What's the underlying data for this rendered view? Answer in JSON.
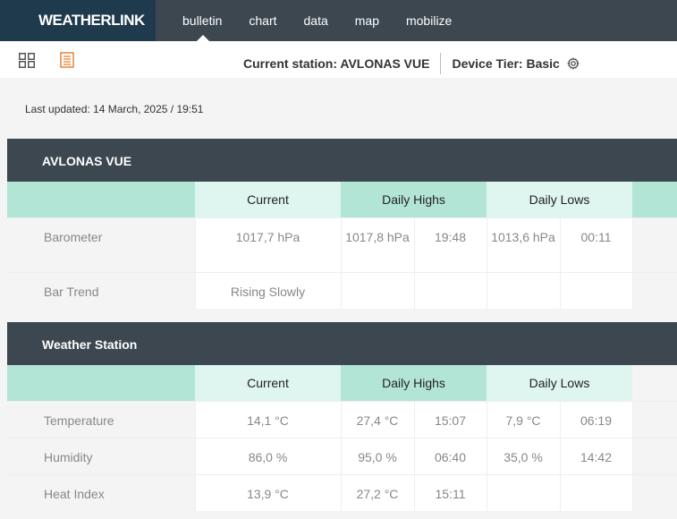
{
  "header": {
    "logo": "WEATHERLINK",
    "nav": [
      {
        "label": "bulletin"
      },
      {
        "label": "chart"
      },
      {
        "label": "data"
      },
      {
        "label": "map"
      },
      {
        "label": "mobilize"
      }
    ]
  },
  "toolbar": {
    "current_station": "Current station: AVLONAS VUE",
    "device_tier": "Device Tier: Basic",
    "grid_icon": "grid-view-icon",
    "list_icon": "list-view-icon",
    "settings_icon": "gear-icon",
    "accent_color": "#e8823a"
  },
  "last_updated": "Last updated: 14 March, 2025 / 19:51",
  "columns": {
    "current": "Current",
    "daily_highs": "Daily Highs",
    "daily_lows": "Daily Lows"
  },
  "sections": [
    {
      "title": "AVLONAS VUE",
      "rows": [
        {
          "label": "Barometer",
          "current": "1017,7 hPa",
          "high": "1017,8 hPa",
          "high_time": "19:48",
          "low": "1013,6 hPa",
          "low_time": "00:11"
        },
        {
          "label": "Bar Trend",
          "current": "Rising Slowly",
          "high": "",
          "high_time": "",
          "low": "",
          "low_time": ""
        }
      ]
    },
    {
      "title": "Weather Station",
      "rows": [
        {
          "label": "Temperature",
          "current": "14,1 °C",
          "high": "27,4 °C",
          "high_time": "15:07",
          "low": "7,9 °C",
          "low_time": "06:19"
        },
        {
          "label": "Humidity",
          "current": "86,0 %",
          "high": "95,0 %",
          "high_time": "06:40",
          "low": "35,0 %",
          "low_time": "14:42"
        },
        {
          "label": "Heat Index",
          "current": "13,9 °C",
          "high": "27,2 °C",
          "high_time": "15:11",
          "low": "",
          "low_time": ""
        }
      ]
    }
  ],
  "colors": {
    "topbar": "#3c474f",
    "logo_bg": "#1f3a4d",
    "col_light": "#dff5ef",
    "col_dark": "#b3e5d7"
  }
}
